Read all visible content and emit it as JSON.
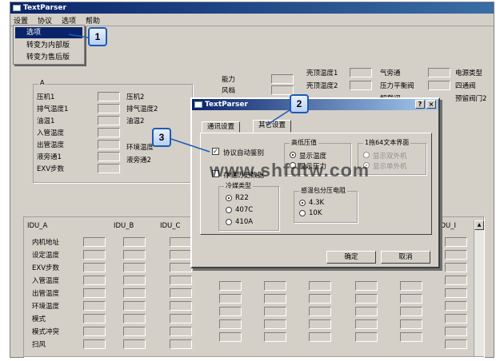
{
  "window": {
    "title": "TextParser"
  },
  "menu": [
    "设置",
    "协议",
    "选项",
    "帮助"
  ],
  "dropdown": [
    "选项",
    "转变为内部版",
    "转变为售后版"
  ],
  "callouts": [
    "1",
    "2",
    "3"
  ],
  "group_a": {
    "title": "A",
    "col1": [
      "压机1",
      "排气温度1",
      "油温1",
      "入管温度",
      "出管温度",
      "液旁通1",
      "EXV步数"
    ],
    "col2": [
      "压机2",
      "排气温度2",
      "油温2",
      "环境温度",
      "液旁通2"
    ]
  },
  "top_right": {
    "col1": [
      "能力",
      "风档"
    ],
    "col2": [
      "壳顶温度1",
      "壳顶温度2"
    ],
    "col3": [
      "气旁通",
      "压力平衡阀",
      "卸载阀"
    ],
    "col4": [
      "电源类型",
      "四通阀",
      "预留阀门2"
    ]
  },
  "idu": {
    "headers": [
      "IDU_A",
      "IDU_B",
      "IDU_C",
      "IDU_I"
    ],
    "rows": [
      "内机地址",
      "设定温度",
      "EXV步数",
      "入管温度",
      "出管温度",
      "环境温度",
      "模式",
      "模式冲突",
      "扫风"
    ]
  },
  "dialog": {
    "title": "TextParser",
    "help_label": "?",
    "close_label": "×",
    "tabs": [
      "通讯设置",
      "其它设置"
    ],
    "auto_detect_label": "协议自动鉴别",
    "hidden_label": "存储历史数据",
    "pressure": {
      "title": "高低压值",
      "options": [
        "显示温度",
        "显示压力"
      ]
    },
    "drag": {
      "title": "1拖64文本界面",
      "options": [
        "显示双外机",
        "显示单外机"
      ]
    },
    "refrigerant": {
      "title": "冷媒类型",
      "options": [
        "R22",
        "407C",
        "410A"
      ]
    },
    "resistor": {
      "title": "感温包分压电阻",
      "options": [
        "4.3K",
        "10K"
      ]
    },
    "ok_label": "确定",
    "cancel_label": "取消"
  },
  "watermark": "www.shfdtw.com"
}
